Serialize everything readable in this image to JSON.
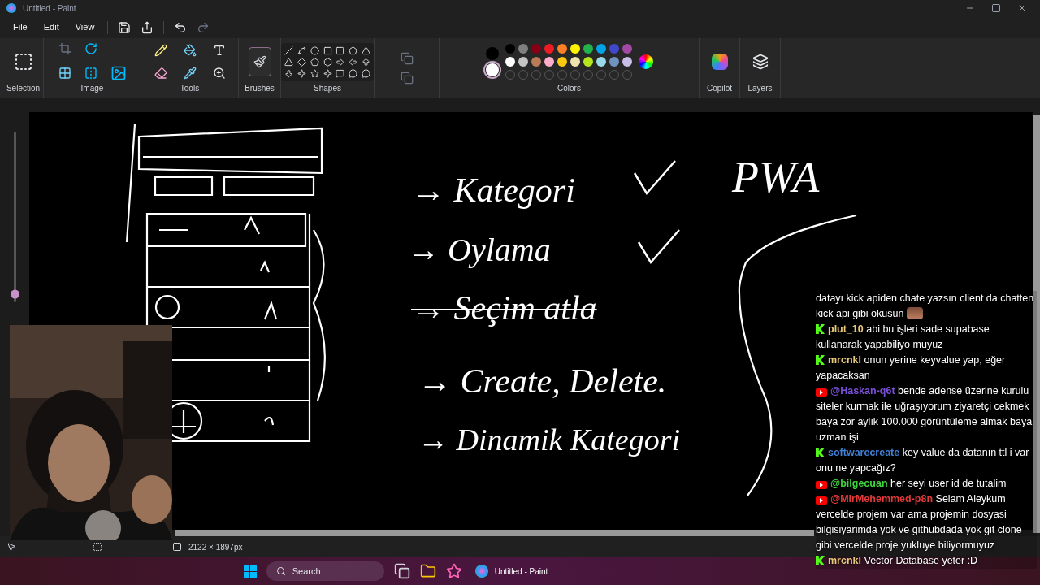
{
  "window": {
    "title": "Untitled - Paint"
  },
  "menu": [
    "File",
    "Edit",
    "View"
  ],
  "ribbon_groups": [
    "Selection",
    "Image",
    "Tools",
    "Brushes",
    "Shapes",
    "Colors",
    "Copilot",
    "Layers"
  ],
  "colors": {
    "current": [
      {
        "color": "#000000",
        "selected": false
      },
      {
        "color": "#ffffff",
        "selected": true
      }
    ],
    "palette": [
      {
        "color": "#000000"
      },
      {
        "color": "#7f7f7f"
      },
      {
        "color": "#880015"
      },
      {
        "color": "#ed1c24"
      },
      {
        "color": "#ff7f27"
      },
      {
        "color": "#fff200"
      },
      {
        "color": "#22b14c"
      },
      {
        "color": "#00a2e8"
      },
      {
        "color": "#3f48cc"
      },
      {
        "color": "#a349a4"
      },
      {
        "color": "#ffffff"
      },
      {
        "color": "#c3c3c3"
      },
      {
        "color": "#b97a57"
      },
      {
        "color": "#ffaec9"
      },
      {
        "color": "#ffc90e"
      },
      {
        "color": "#efe4b0"
      },
      {
        "color": "#b5e61d"
      },
      {
        "color": "#99d9ea"
      },
      {
        "color": "#7092be"
      },
      {
        "color": "#c8bfe7"
      }
    ]
  },
  "zoom_slider": {
    "level": 0.05
  },
  "canvas": {
    "heading": "PWA",
    "notes": [
      {
        "text": "→ Kategori",
        "struck": false,
        "checked": true
      },
      {
        "text": "→ Oylama",
        "struck": false,
        "checked": true
      },
      {
        "text": "→ Seçim atla",
        "struck": true,
        "checked": false
      },
      {
        "text": "→ Create, Delete.",
        "struck": false,
        "checked": false
      },
      {
        "text": "→ Dinamik Kategori",
        "struck": false,
        "checked": false
      }
    ]
  },
  "status_bar": {
    "image_size": "2122 × 1897px"
  },
  "chat": [
    {
      "text": "datayı kick apiden chate yazsın client da chatten kick api gibi okusun",
      "emote": true
    },
    {
      "kind": "kick",
      "user": "plut_10",
      "color": "#e8c87a",
      "text": "abi bu işleri sade supabase kullanarak yapabiliyo muyuz"
    },
    {
      "kind": "kick",
      "user": "mrcnkl",
      "color": "#e8c87a",
      "text": "onun yerine keyvalue yap, eğer yapacaksan"
    },
    {
      "kind": "youtube",
      "user": "@Haskan-q6t",
      "color": "#7a4fd8",
      "text": "bende adense üzerine kurulu siteler kurmak ile uğraşıyorum ziyaretçi cekmek baya zor aylık 100.000 görüntüleme almak baya uzman işi"
    },
    {
      "kind": "kick",
      "user": "softwarecreate",
      "color": "#3f7fd6",
      "text": "key value da datanın ttl i var onu ne yapcağız?"
    },
    {
      "kind": "youtube",
      "user": "@bilgecuan",
      "color": "#3fd23f",
      "text": "her seyi user id de tutalim"
    },
    {
      "kind": "youtube",
      "user": "@MirMehemmed-p8n",
      "color": "#e03a3a",
      "text": "Selam Aleykum vercelde projem var ama projemin dosyasi bilgisiyarimda yok ve githubdada yok git clone gibi vercelde proje yukluye biliyormuyuz"
    },
    {
      "kind": "kick",
      "user": "mrcnkl",
      "color": "#e8c87a",
      "text": "Vector Database yeter :D"
    }
  ],
  "taskbar": {
    "search_placeholder": "Search",
    "apps": [
      {
        "title": "Untitled - Paint"
      }
    ]
  }
}
